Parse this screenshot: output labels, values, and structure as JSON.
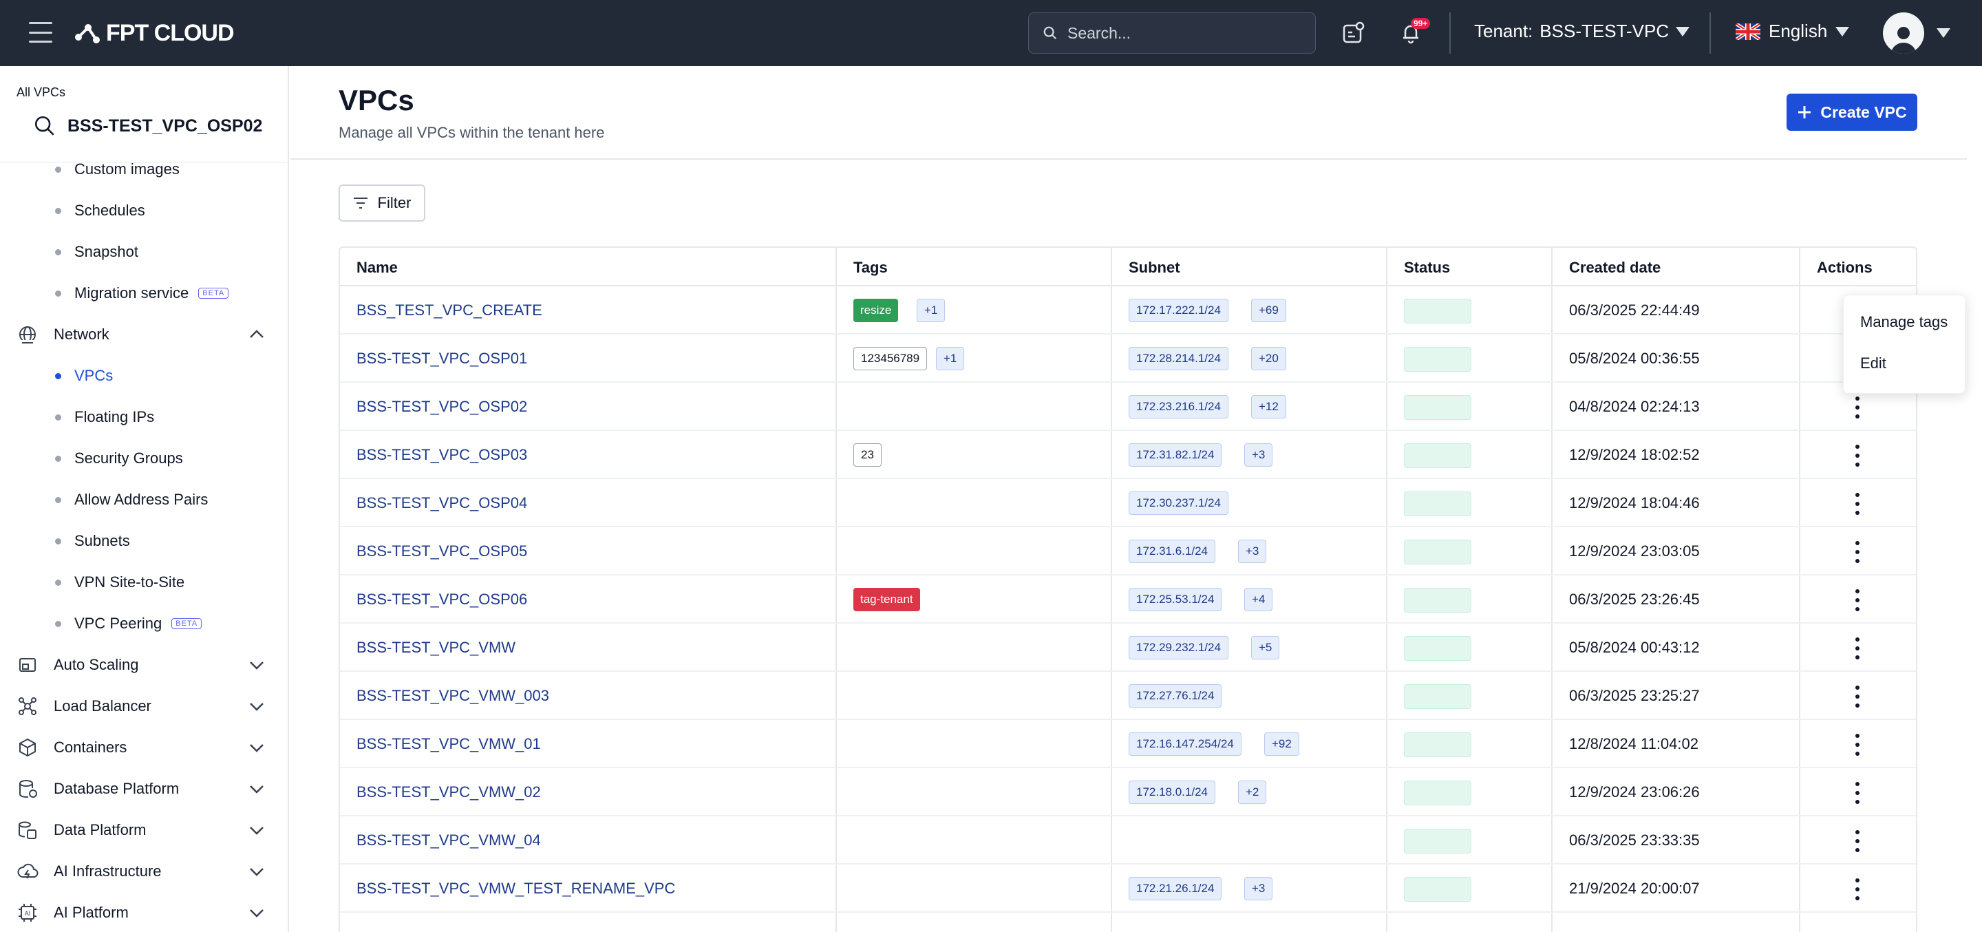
{
  "topbar": {
    "brand": "FPT CLOUD",
    "search_placeholder": "Search...",
    "notification_badge": "99+",
    "tenant_label": "Tenant:",
    "tenant_value": "BSS-TEST-VPC",
    "language": "English"
  },
  "sidebar": {
    "breadcrumb": "All VPCs",
    "project": "BSS-TEST_VPC_OSP02",
    "sub_items": [
      {
        "label": "Custom images",
        "active": false
      },
      {
        "label": "Schedules",
        "active": false
      },
      {
        "label": "Snapshot",
        "active": false
      },
      {
        "label": "Migration service",
        "active": false,
        "badge": "BETA"
      },
      {
        "label": "Network",
        "group": true,
        "icon": "network-icon",
        "expanded": true
      },
      {
        "label": "VPCs",
        "active": true
      },
      {
        "label": "Floating IPs",
        "active": false
      },
      {
        "label": "Security Groups",
        "active": false
      },
      {
        "label": "Allow Address Pairs",
        "active": false
      },
      {
        "label": "Subnets",
        "active": false
      },
      {
        "label": "VPN Site-to-Site",
        "active": false
      },
      {
        "label": "VPC Peering",
        "active": false,
        "badge": "BETA"
      }
    ],
    "groups": [
      {
        "label": "Auto Scaling",
        "icon": "auto-scaling-icon"
      },
      {
        "label": "Load Balancer",
        "icon": "load-balancer-icon"
      },
      {
        "label": "Containers",
        "icon": "containers-icon"
      },
      {
        "label": "Database Platform",
        "icon": "database-icon"
      },
      {
        "label": "Data Platform",
        "icon": "data-platform-icon"
      },
      {
        "label": "AI Infrastructure",
        "icon": "ai-infrastructure-icon"
      },
      {
        "label": "AI Platform",
        "icon": "ai-platform-icon"
      }
    ]
  },
  "page": {
    "title": "VPCs",
    "subtitle": "Manage all VPCs within the tenant here",
    "create_button": "Create VPC",
    "filter_button": "Filter"
  },
  "table": {
    "columns": [
      "Name",
      "Tags",
      "Subnet",
      "Status",
      "Created date",
      "Actions"
    ],
    "rows": [
      {
        "name": "BSS_TEST_VPC_CREATE",
        "tags": [
          {
            "text": "resize",
            "style": "green"
          },
          {
            "text": "+1",
            "style": "blue"
          }
        ],
        "subnets": [
          "172.17.222.1/24",
          "+69"
        ],
        "created": "06/3/2025 22:44:49"
      },
      {
        "name": "BSS-TEST_VPC_OSP01",
        "tags": [
          {
            "text": "123456789",
            "style": "plain"
          },
          {
            "text": "+1",
            "style": "blue"
          }
        ],
        "subnets": [
          "172.28.214.1/24",
          "+20"
        ],
        "created": "05/8/2024 00:36:55"
      },
      {
        "name": "BSS-TEST_VPC_OSP02",
        "tags": [],
        "subnets": [
          "172.23.216.1/24",
          "+12"
        ],
        "created": "04/8/2024 02:24:13"
      },
      {
        "name": "BSS-TEST_VPC_OSP03",
        "tags": [
          {
            "text": "23",
            "style": "plain"
          }
        ],
        "subnets": [
          "172.31.82.1/24",
          "+3"
        ],
        "created": "12/9/2024 18:02:52"
      },
      {
        "name": "BSS-TEST_VPC_OSP04",
        "tags": [],
        "subnets": [
          "172.30.237.1/24"
        ],
        "created": "12/9/2024 18:04:46"
      },
      {
        "name": "BSS-TEST_VPC_OSP05",
        "tags": [],
        "subnets": [
          "172.31.6.1/24",
          "+3"
        ],
        "created": "12/9/2024 23:03:05"
      },
      {
        "name": "BSS-TEST_VPC_OSP06",
        "tags": [
          {
            "text": "tag-tenant",
            "style": "red"
          }
        ],
        "subnets": [
          "172.25.53.1/24",
          "+4"
        ],
        "created": "06/3/2025 23:26:45"
      },
      {
        "name": "BSS-TEST_VPC_VMW",
        "tags": [],
        "subnets": [
          "172.29.232.1/24",
          "+5"
        ],
        "created": "05/8/2024 00:43:12"
      },
      {
        "name": "BSS-TEST_VPC_VMW_003",
        "tags": [],
        "subnets": [
          "172.27.76.1/24"
        ],
        "created": "06/3/2025 23:25:27"
      },
      {
        "name": "BSS-TEST_VPC_VMW_01",
        "tags": [],
        "subnets": [
          "172.16.147.254/24",
          "+92"
        ],
        "created": "12/8/2024 11:04:02"
      },
      {
        "name": "BSS-TEST_VPC_VMW_02",
        "tags": [],
        "subnets": [
          "172.18.0.1/24",
          "+2"
        ],
        "created": "12/9/2024 23:06:26"
      },
      {
        "name": "BSS-TEST_VPC_VMW_04",
        "tags": [],
        "subnets": [],
        "created": "06/3/2025 23:33:35"
      },
      {
        "name": "BSS-TEST_VPC_VMW_TEST_RENAME_VPC",
        "tags": [],
        "subnets": [
          "172.21.26.1/24",
          "+3"
        ],
        "created": "21/9/2024 20:00:07"
      }
    ]
  },
  "context_menu": {
    "items": [
      "Manage tags",
      "Edit"
    ]
  },
  "colors": {
    "topbar": "#222a38",
    "accent": "#1d4ed8",
    "tag_green": "#2e9e57",
    "tag_red": "#dc3545",
    "status_fill": "#e3f7ee"
  }
}
